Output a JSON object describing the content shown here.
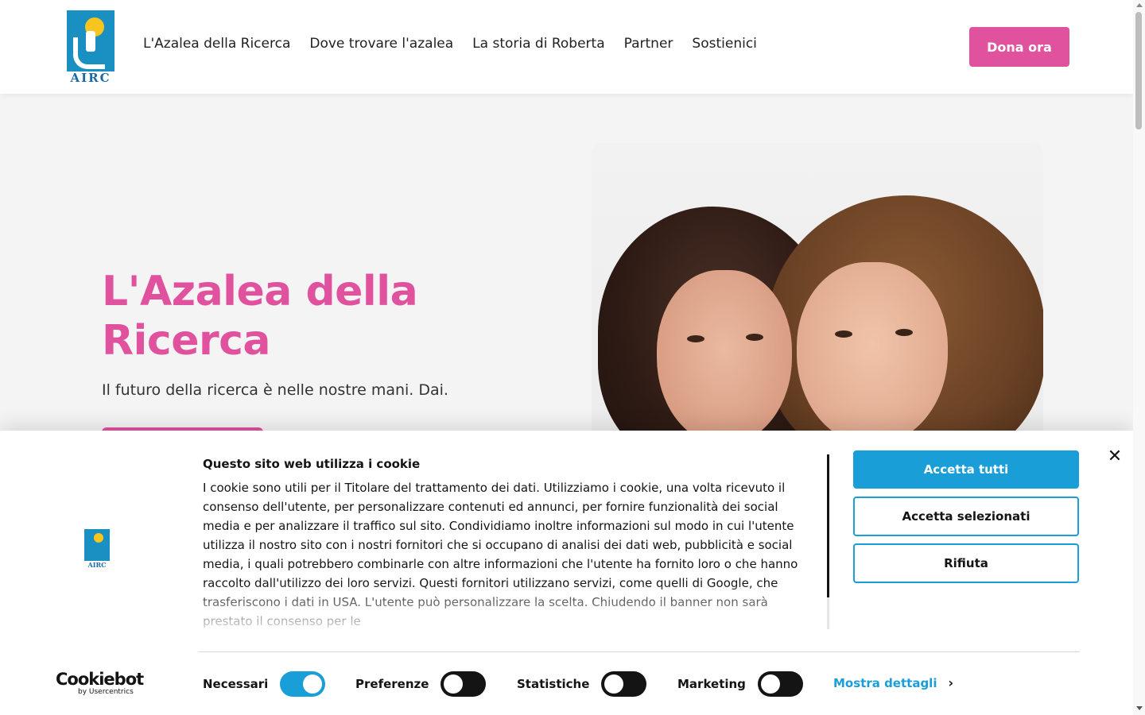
{
  "brand": {
    "logo_text": "AIRC",
    "accent": "#e0519e",
    "cookie_accent": "#1a9ed8"
  },
  "nav": {
    "items": [
      {
        "label": "L'Azalea della Ricerca"
      },
      {
        "label": "Dove trovare l'azalea"
      },
      {
        "label": "La storia di Roberta"
      },
      {
        "label": "Partner"
      },
      {
        "label": "Sostienici"
      }
    ],
    "donate_label": "Dona ora"
  },
  "hero": {
    "title": "L'Azalea della Ricerca",
    "subtitle": "Il futuro della ricerca è nelle nostre mani. Dai."
  },
  "cookie_banner": {
    "logo_text": "AIRC",
    "title": "Questo sito web utilizza i cookie",
    "body": "I cookie sono utili per il Titolare del trattamento dei dati. Utilizziamo i cookie, una volta ricevuto il consenso dell'utente, per personalizzare contenuti ed annunci, per fornire funzionalità dei social media e per analizzare il traffico sul sito. Condividiamo inoltre informazioni sul modo in cui l'utente utilizza il nostro sito con i nostri fornitori che si occupano di analisi dei dati web, pubblicità e social media, i quali potrebbero combinarle con altre informazioni che l'utente ha fornito loro o che hanno raccolto dall'utilizzo dei loro servizi. Questi fornitori utilizzano servizi, come quelli di Google, che trasferiscono i dati in USA. L'utente può personalizzare la scelta. Chiudendo il banner non sarà prestato il consenso per le",
    "accept_all": "Accetta tutti",
    "accept_selected": "Accetta selezionati",
    "reject": "Rifiuta",
    "cookiebot_brand": "Cookiebot",
    "cookiebot_sub": "by Usercentrics",
    "toggles": [
      {
        "label": "Necessari",
        "on": true
      },
      {
        "label": "Preferenze",
        "on": false
      },
      {
        "label": "Statistiche",
        "on": false
      },
      {
        "label": "Marketing",
        "on": false
      }
    ],
    "details_label": "Mostra dettagli"
  }
}
